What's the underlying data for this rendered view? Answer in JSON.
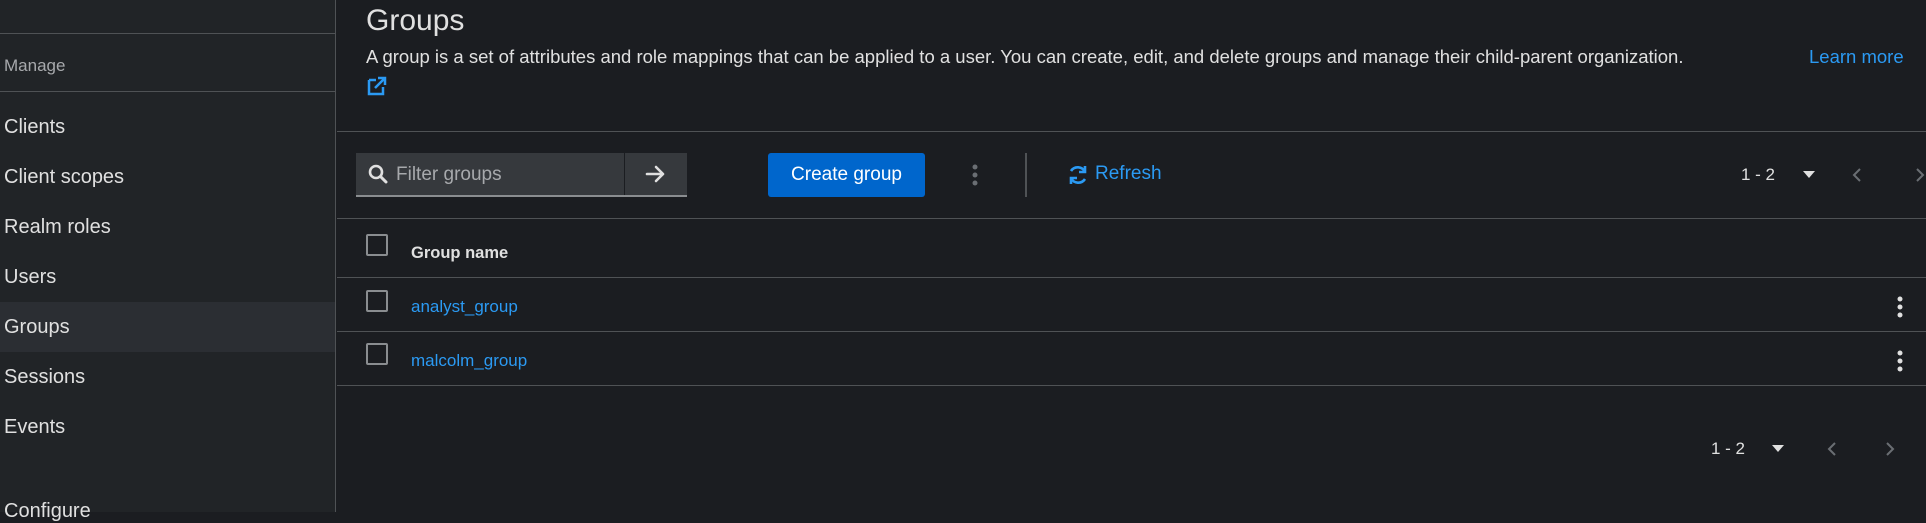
{
  "sidebar": {
    "section_label": "Manage",
    "items": [
      {
        "label": "Clients"
      },
      {
        "label": "Client scopes"
      },
      {
        "label": "Realm roles"
      },
      {
        "label": "Users"
      },
      {
        "label": "Groups",
        "active": true
      },
      {
        "label": "Sessions"
      },
      {
        "label": "Events"
      }
    ],
    "partial_label": "Configure"
  },
  "page": {
    "title": "Groups",
    "description": "A group is a set of attributes and role mappings that can be applied to a user. You can create, edit, and delete groups and manage their child-parent organization.",
    "learn_more": "Learn more"
  },
  "toolbar": {
    "search_placeholder": "Filter groups",
    "create_label": "Create group",
    "refresh_label": "Refresh",
    "pagination_top": "1 - 2"
  },
  "table": {
    "columns": [
      "Group name"
    ],
    "rows": [
      {
        "name": "analyst_group"
      },
      {
        "name": "malcolm_group"
      }
    ]
  },
  "pagination_bottom": "1 - 2",
  "colors": {
    "accent": "#0066cc",
    "link": "#2b9af3",
    "background": "#1b1d21",
    "sidebar": "#212427"
  },
  "icons": [
    "search-icon",
    "arrow-right-icon",
    "external-link-icon",
    "refresh-icon",
    "kebab-icon",
    "caret-down-icon",
    "chevron-left-icon",
    "chevron-right-icon"
  ]
}
